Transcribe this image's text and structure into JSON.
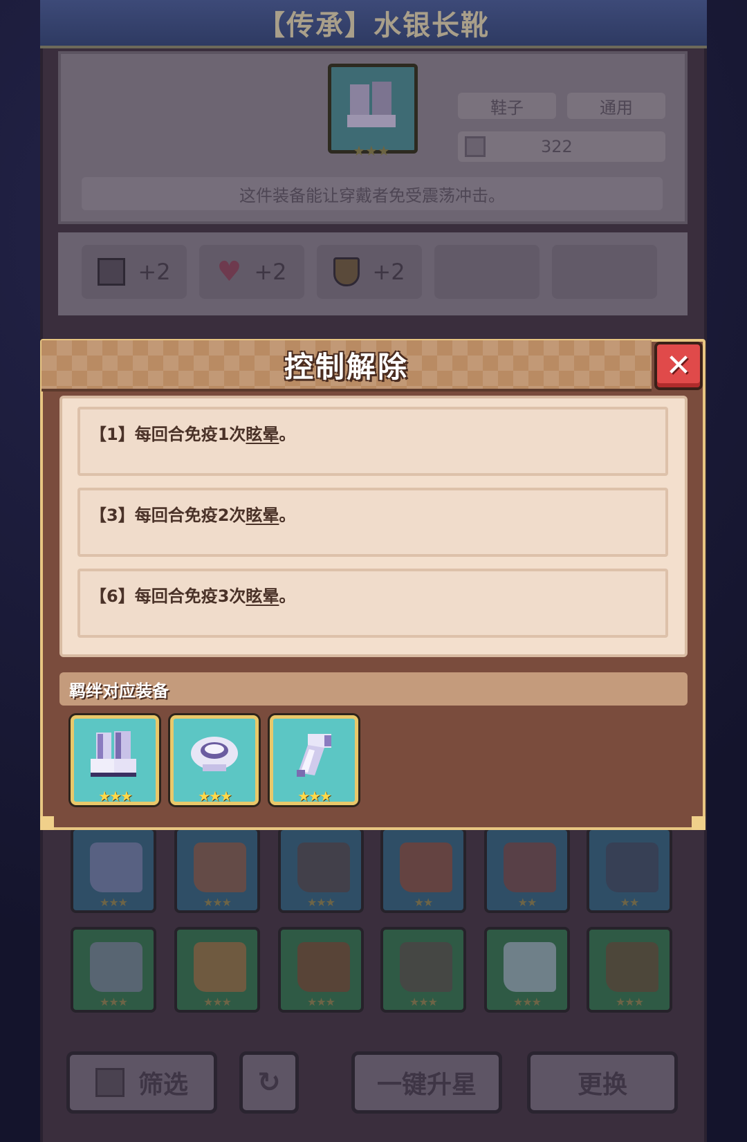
{
  "item": {
    "title": "【传承】水银长靴",
    "type_label": "鞋子",
    "class_label": "通用",
    "power_value": "322",
    "description": "这件装备能让穿戴者免受震荡冲击。",
    "stars": "★★★",
    "stats": [
      {
        "icon": "book-icon",
        "value": "+2"
      },
      {
        "icon": "heart-icon",
        "value": "+2"
      },
      {
        "icon": "shield-icon",
        "value": "+2"
      }
    ]
  },
  "modal": {
    "title": "控制解除",
    "close_icon": "close-icon",
    "effects": [
      {
        "prefix": "【1】每回合免疫1次",
        "keyword": "眩晕",
        "suffix": "。"
      },
      {
        "prefix": "【3】每回合免疫2次",
        "keyword": "眩晕",
        "suffix": "。"
      },
      {
        "prefix": "【6】每回合免疫3次",
        "keyword": "眩晕",
        "suffix": "。"
      }
    ],
    "bond_header": "羁绊对应装备",
    "bond_items": [
      {
        "icon": "boots-icon",
        "stars": "★★★"
      },
      {
        "icon": "cape-icon",
        "stars": "★★★"
      },
      {
        "icon": "glove-icon",
        "stars": "★★★"
      }
    ]
  },
  "inventory": {
    "row1_stars": [
      "★★★",
      "★★★",
      "★★★",
      "★★",
      "★★",
      "★★"
    ],
    "row2_stars": [
      "★★★",
      "★★★",
      "★★★",
      "★★★",
      "★★★",
      "★★★"
    ]
  },
  "buttons": {
    "filter": "筛选",
    "upgrade_all": "一键升星",
    "replace": "更换"
  },
  "colors": {
    "modal_bg": "#7a4c3d",
    "modal_border": "#e8c682",
    "close_red": "#e04a4a",
    "effect_panel": "#f3dfcd",
    "bond_slot_bg": "#5cc6c4",
    "star_gold": "#ffd94a"
  }
}
